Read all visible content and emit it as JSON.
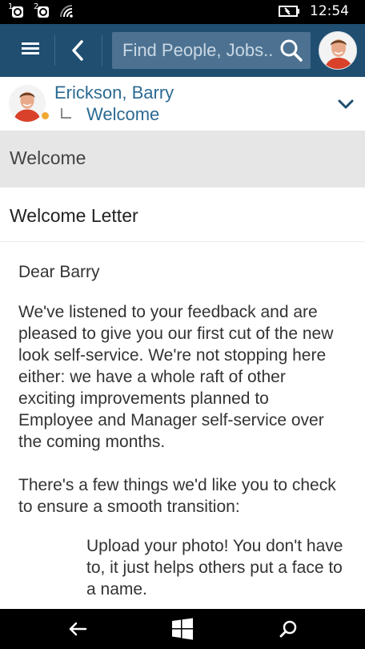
{
  "status_bar": {
    "sim1": "1",
    "sim2": "2",
    "time": "12:54"
  },
  "header": {
    "search_placeholder": "Find People, Jobs...",
    "search_value_visible": "Find People, Jo",
    "brand_color": "#1f4e70"
  },
  "person": {
    "name": "Erickson, Barry",
    "sub_item": "Welcome",
    "status_color": "#f0a830"
  },
  "section": {
    "title": "Welcome"
  },
  "letter": {
    "title": "Welcome Letter",
    "greeting": "Dear Barry",
    "paragraph1": "We've listened to your feedback and are pleased to give you our first cut of the new look self-service. We're not stopping here either: we have a whole raft of other exciting improvements planned to Employee and Manager self-service over the coming months.",
    "paragraph2": "There's a few things we'd like you to check to ensure a smooth transition:",
    "list_item1": "Upload your photo! You don't have to, it just helps others put a face to a name."
  },
  "icons": {
    "menu": "hamburger-icon",
    "back": "back-chevron-icon",
    "search": "search-icon",
    "expand": "chevron-down-icon",
    "nav_back": "back-arrow-icon",
    "nav_home": "windows-logo-icon",
    "nav_search": "search-icon"
  }
}
